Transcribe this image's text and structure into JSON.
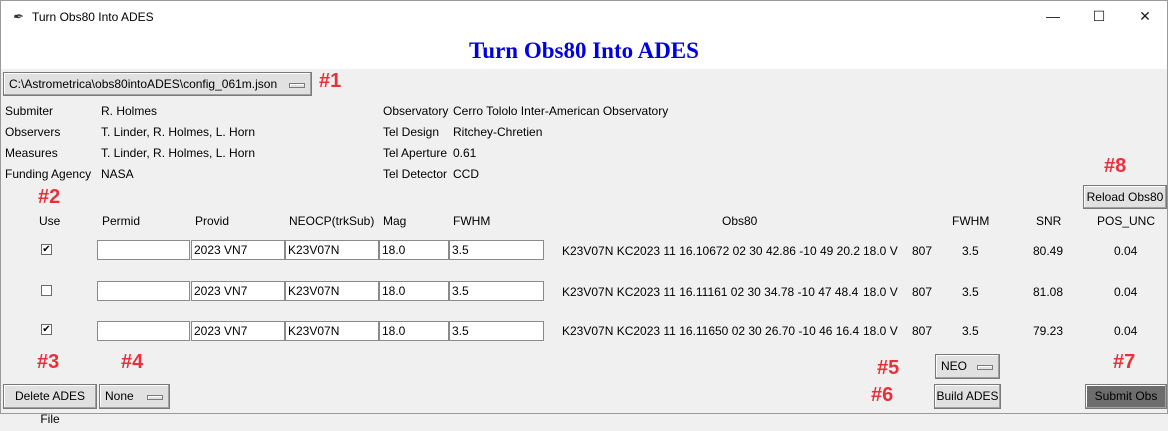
{
  "window": {
    "title": "Turn Obs80 Into ADES",
    "icon": "feather-icon",
    "controls": {
      "minimize": "—",
      "maximize": "☐",
      "close": "✕"
    }
  },
  "banner": {
    "title": "Turn Obs80 Into ADES",
    "color": "#0000e0"
  },
  "annotation_color": "#e8303a",
  "annotations": [
    "#1",
    "#2",
    "#3",
    "#4",
    "#5",
    "#6",
    "#7",
    "#8"
  ],
  "config": {
    "selected": "C:\\Astrometrica\\obs80intoADES\\config_061m.json"
  },
  "info_left": [
    {
      "label": "Submiter",
      "value": "R. Holmes"
    },
    {
      "label": "Observers",
      "value": "T. Linder, R. Holmes, L. Horn"
    },
    {
      "label": "Measures",
      "value": "T. Linder, R. Holmes, L. Horn"
    },
    {
      "label": "Funding Agency",
      "value": "NASA"
    }
  ],
  "info_right": [
    {
      "label": "Observatory",
      "value": "Cerro Tololo Inter-American Observatory"
    },
    {
      "label": "Tel Design",
      "value": "Ritchey-Chretien"
    },
    {
      "label": "Tel Aperture",
      "value": "0.61"
    },
    {
      "label": "Tel Detector",
      "value": "CCD"
    }
  ],
  "buttons": {
    "reload": "Reload Obs80",
    "delete": "Delete ADES File",
    "build": "Build ADES",
    "submit": "Submit Obs"
  },
  "dropdowns": {
    "none": "None",
    "neo": "NEO"
  },
  "headers": {
    "use": "Use",
    "permid": "Permid",
    "provid": "Provid",
    "neocp": "NEOCP(trkSub)",
    "mag": "Mag",
    "fwhm": "FWHM",
    "obs80": "Obs80",
    "fwhm2": "FWHM",
    "snr": "SNR",
    "pos_unc": "POS_UNC"
  },
  "rows": [
    {
      "use": "✔",
      "permid": "",
      "provid": "2023 VN7",
      "neocp": "K23V07N",
      "mag": "18.0",
      "fwhm": "3.5",
      "obs80": "K23V07N KC2023 11 16.10672 02 30 42.86 -10 49 20.2",
      "magband": "18.0 V",
      "code": "807",
      "fwhm2": "3.5",
      "snr": "80.49",
      "pos_unc": "0.04"
    },
    {
      "use": "",
      "permid": "",
      "provid": "2023 VN7",
      "neocp": "K23V07N",
      "mag": "18.0",
      "fwhm": "3.5",
      "obs80": "K23V07N KC2023 11 16.11161 02 30 34.78 -10 47 48.4",
      "magband": "18.0 V",
      "code": "807",
      "fwhm2": "3.5",
      "snr": "81.08",
      "pos_unc": "0.04"
    },
    {
      "use": "✔",
      "permid": "",
      "provid": "2023 VN7",
      "neocp": "K23V07N",
      "mag": "18.0",
      "fwhm": "3.5",
      "obs80": "K23V07N KC2023 11 16.11650 02 30 26.70 -10 46 16.4",
      "magband": "18.0 V",
      "code": "807",
      "fwhm2": "3.5",
      "snr": "79.23",
      "pos_unc": "0.04"
    }
  ]
}
